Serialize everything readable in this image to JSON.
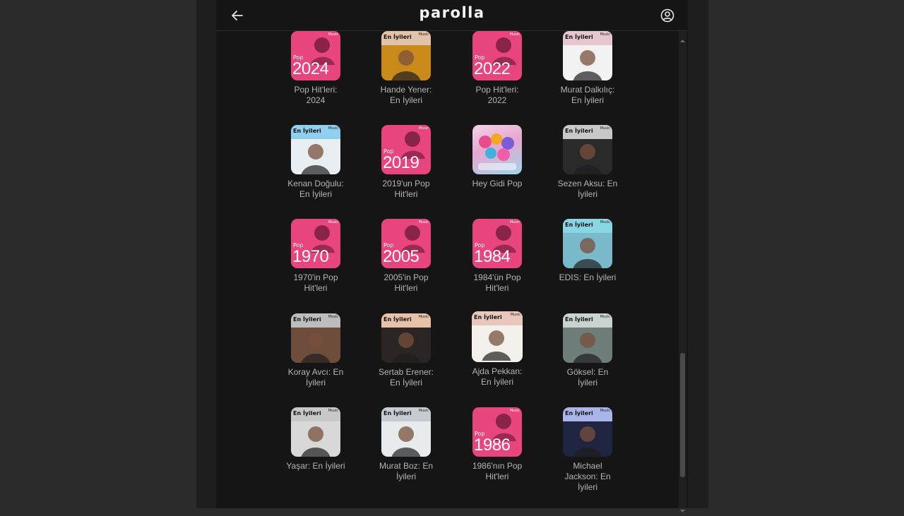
{
  "header": {
    "title": "parolla",
    "back_icon": "arrow-left-icon",
    "profile_icon": "user-circle-icon"
  },
  "colors": {
    "background": "#151515",
    "pop_pink": "#e8447e",
    "caption": "#b5b5b5"
  },
  "cover_labels": {
    "best_of": "En İyileri",
    "pop": "Pop",
    "apple_music": "Music"
  },
  "playlists": [
    {
      "caption": "Pop Hit'leri:\n2024",
      "kind": "pop",
      "year": "2024"
    },
    {
      "caption": "Hande Yener:\nEn İyileri",
      "kind": "best",
      "band": "#e2c2a8",
      "photo": "#c98a1a"
    },
    {
      "caption": "Pop Hit'leri:\n2022",
      "kind": "pop",
      "year": "2022"
    },
    {
      "caption": "Murat Dalkılıç:\nEn İyileri",
      "kind": "best",
      "band": "#e7c7cf",
      "photo": "#f2f2f2"
    },
    {
      "caption": "Kenan Doğulu:\nEn İyileri",
      "kind": "best",
      "band": "#8fd0f0",
      "photo": "#e9eef2"
    },
    {
      "caption": "2019'un Pop\nHit'leri",
      "kind": "pop",
      "year": "2019"
    },
    {
      "caption": "Hey Gidi Pop",
      "kind": "special"
    },
    {
      "caption": "Sezen Aksu: En\nİyileri",
      "kind": "best",
      "band": "#c8c8c8",
      "photo": "#2a2a2a"
    },
    {
      "caption": "1970'in Pop\nHit'leri",
      "kind": "pop",
      "year": "1970"
    },
    {
      "caption": "2005'in Pop\nHit'leri",
      "kind": "pop",
      "year": "2005"
    },
    {
      "caption": "1984'ün Pop\nHit'leri",
      "kind": "pop",
      "year": "1984"
    },
    {
      "caption": "EDIS: En İyileri",
      "kind": "best",
      "band": "#88d6e4",
      "photo": "#79b9c9"
    },
    {
      "caption": "Koray Avcı: En\nİyileri",
      "kind": "best",
      "band": "#bdbdbd",
      "photo": "#6e4d3d"
    },
    {
      "caption": "Sertab Erener:\nEn İyileri",
      "kind": "best",
      "band": "#e7c2a8",
      "photo": "#2b2523"
    },
    {
      "caption": "Ajda Pekkan:\nEn İyileri",
      "kind": "best",
      "band": "#e9c7bd",
      "photo": "#f4f1ec"
    },
    {
      "caption": "Göksel: En\nİyileri",
      "kind": "best",
      "band": "#c9d4d0",
      "photo": "#6e7d7a"
    },
    {
      "caption": "Yaşar: En İyileri",
      "kind": "best",
      "band": "#c8c8c8",
      "photo": "#d8d8d8"
    },
    {
      "caption": "Murat Boz: En\nİyileri",
      "kind": "best",
      "band": "#c6cbd1",
      "photo": "#e8ebee"
    },
    {
      "caption": "1986'nın Pop\nHit'leri",
      "kind": "pop",
      "year": "1986"
    },
    {
      "caption": "Michael\nJackson: En\nİyileri",
      "kind": "best",
      "band": "#a9b4e9",
      "photo": "#1f2540"
    }
  ]
}
